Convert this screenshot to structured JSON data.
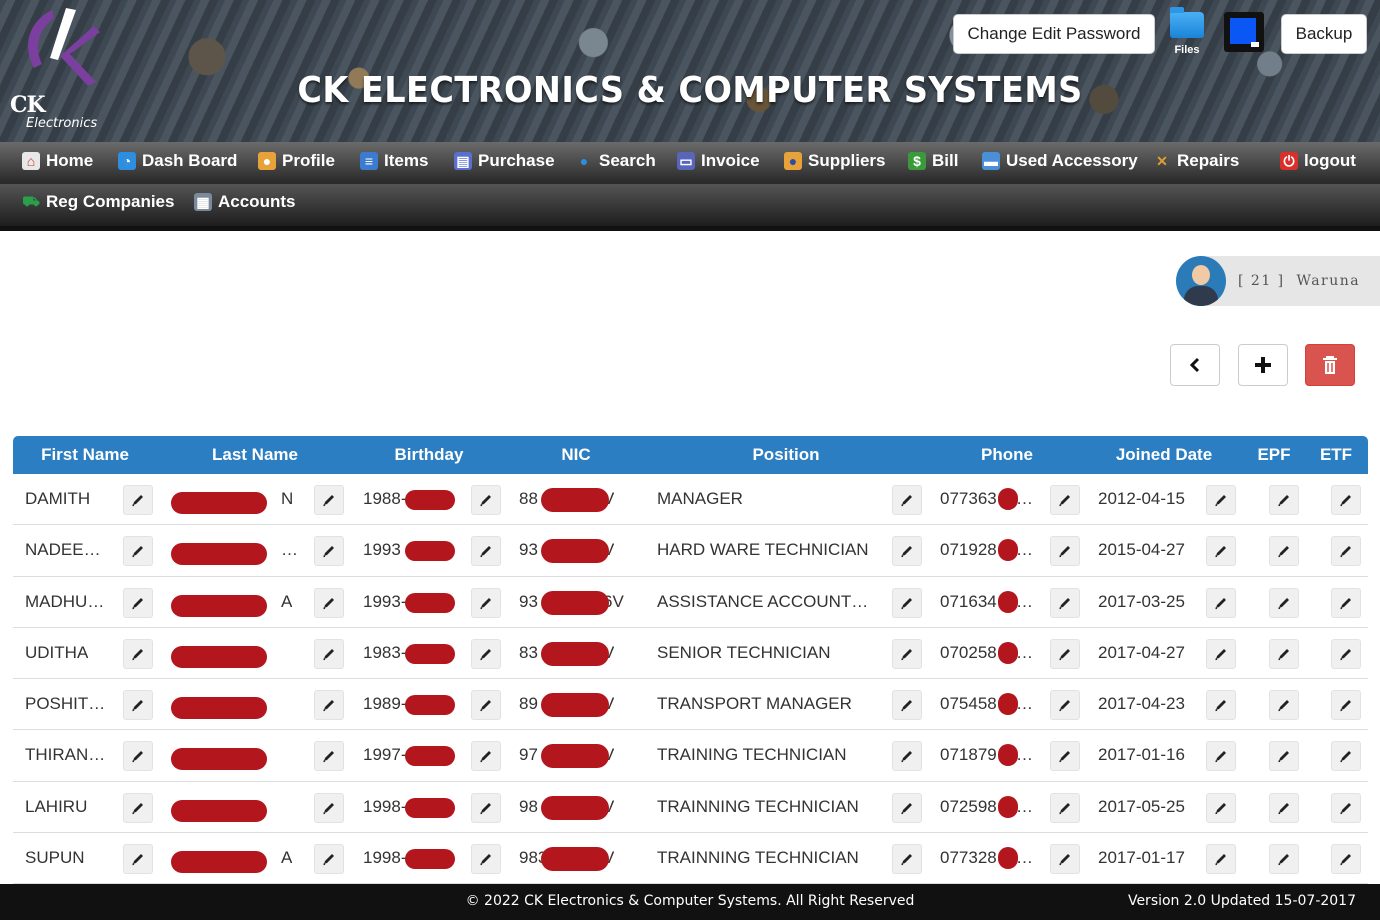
{
  "app": {
    "logo_text": "CK",
    "logo_subtext": "Electronics",
    "title": "CK ELECTRONICS & COMPUTER SYSTEMS"
  },
  "header_buttons": {
    "change_password": "Change Edit Password",
    "files_label": "Files",
    "backup": "Backup"
  },
  "nav": {
    "row1": [
      {
        "label": "Home",
        "icon": "home-icon"
      },
      {
        "label": "Dash Board",
        "icon": "dashboard-icon"
      },
      {
        "label": "Profile",
        "icon": "user-icon"
      },
      {
        "label": "Items",
        "icon": "list-icon"
      },
      {
        "label": "Purchase",
        "icon": "document-icon"
      },
      {
        "label": "Search",
        "icon": "search-icon"
      },
      {
        "label": "Invoice",
        "icon": "keyboard-icon"
      },
      {
        "label": "Suppliers",
        "icon": "supplier-icon"
      },
      {
        "label": "Bill",
        "icon": "money-icon"
      },
      {
        "label": "Used Accessory",
        "icon": "monitor-icon"
      },
      {
        "label": "Repairs",
        "icon": "tools-icon"
      },
      {
        "label": "logout",
        "icon": "power-icon"
      }
    ],
    "row2": [
      {
        "label": "Reg Companies",
        "icon": "cart-icon"
      },
      {
        "label": "Accounts",
        "icon": "calculator-icon"
      }
    ]
  },
  "user": {
    "label": "[ 21 ]  Waruna"
  },
  "colors": {
    "header_blue": "#2a7ec1",
    "delete_red": "#d9534f",
    "redaction": "#b3161c"
  },
  "table": {
    "columns": [
      "First Name",
      "Last Name",
      "Birthday",
      "NIC",
      "Position",
      "Phone",
      "Joined Date",
      "EPF",
      "ETF"
    ],
    "rows": [
      {
        "first": "DAMITH",
        "last": "",
        "last_tail": "N",
        "birthday": "1988-",
        "nic": "88",
        "nic_tail": "V",
        "position": "MANAGER",
        "phone": "077363",
        "joined": "2012-04-15"
      },
      {
        "first": "NADEE…",
        "last": "",
        "last_tail": "…",
        "birthday": "1993",
        "nic": "93",
        "nic_tail": "V",
        "position": "HARD WARE TECHNICIAN",
        "phone": "071928",
        "joined": "2015-04-27"
      },
      {
        "first": "MADHU…",
        "last": "",
        "last_tail": "A",
        "birthday": "1993-",
        "nic": "93",
        "nic_tail": "6V",
        "position": "ASSISTANCE ACCOUNT…",
        "phone": "071634",
        "joined": "2017-03-25"
      },
      {
        "first": "UDITHA",
        "last": "",
        "last_tail": "",
        "birthday": "1983-",
        "nic": "83",
        "nic_tail": "V",
        "position": "SENIOR TECHNICIAN",
        "phone": "070258",
        "joined": "2017-04-27"
      },
      {
        "first": "POSHIT…",
        "last": "",
        "last_tail": "",
        "birthday": "1989-",
        "nic": "89",
        "nic_tail": "V",
        "position": "TRANSPORT MANAGER",
        "phone": "075458",
        "joined": "2017-04-23"
      },
      {
        "first": "THIRAN…",
        "last": "",
        "last_tail": "",
        "birthday": "1997-",
        "nic": "97",
        "nic_tail": "V",
        "position": "TRAINING TECHNICIAN",
        "phone": "071879",
        "joined": "2017-01-16"
      },
      {
        "first": "LAHIRU",
        "last": "",
        "last_tail": "",
        "birthday": "1998-1",
        "nic": "98",
        "nic_tail": "V",
        "position": "TRAINNING TECHNICIAN",
        "phone": "072598",
        "joined": "2017-05-25"
      },
      {
        "first": "SUPUN",
        "last": "",
        "last_tail": "A",
        "birthday": "1998-1",
        "nic": "983",
        "nic_tail": "V",
        "position": "TRAINNING TECHNICIAN",
        "phone": "077328",
        "joined": "2017-01-17"
      }
    ]
  },
  "footer": {
    "copyright": "© 2022  CK Electronics & Computer Systems. All Right Reserved",
    "version": "Version 2.0 Updated 15-07-2017"
  }
}
